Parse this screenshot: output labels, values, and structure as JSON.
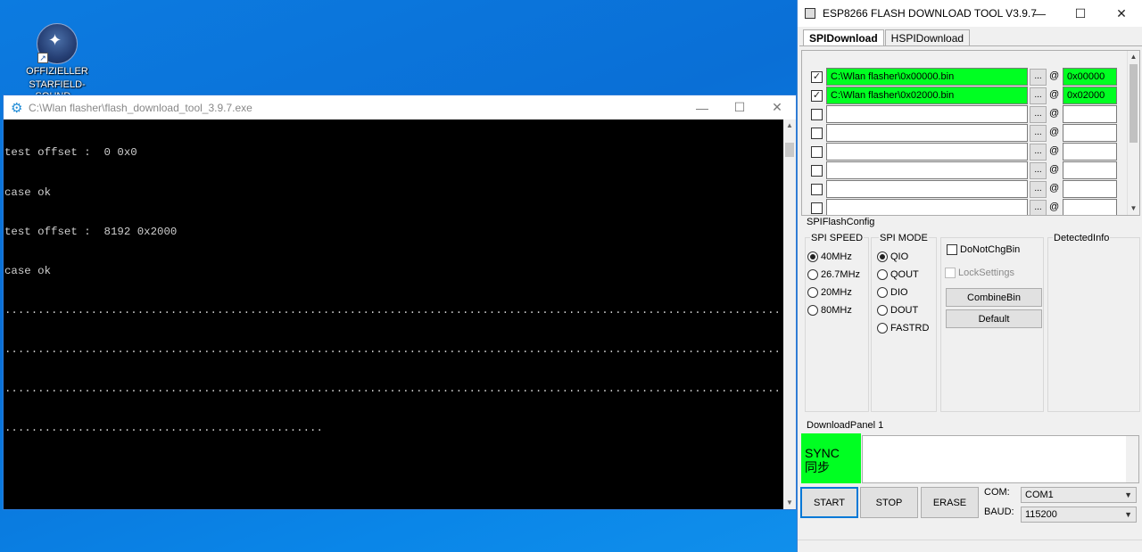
{
  "desktop": {
    "icon_label_1": "OFFIZIELLER",
    "icon_label_2": "STARFIELD-SOUND..."
  },
  "console": {
    "title": "C:\\Wlan flasher\\flash_download_tool_3.9.7.exe",
    "lines": [
      "test offset :  0 0x0",
      "case ok",
      "test offset :  8192 0x2000",
      "case ok",
      "................................................................................................................................................................",
      "................................................................................................................................................................",
      "................................................................................................................................................................",
      "................................................"
    ]
  },
  "esp": {
    "title": "ESP8266 FLASH DOWNLOAD TOOL V3.9.7",
    "tabs": [
      "SPIDownload",
      "HSPIDownload"
    ],
    "files": [
      {
        "checked": true,
        "path": "C:\\Wlan flasher\\0x00000.bin",
        "addr": "0x00000"
      },
      {
        "checked": true,
        "path": "C:\\Wlan flasher\\0x02000.bin",
        "addr": "0x02000"
      },
      {
        "checked": false,
        "path": "",
        "addr": ""
      },
      {
        "checked": false,
        "path": "",
        "addr": ""
      },
      {
        "checked": false,
        "path": "",
        "addr": ""
      },
      {
        "checked": false,
        "path": "",
        "addr": ""
      },
      {
        "checked": false,
        "path": "",
        "addr": ""
      },
      {
        "checked": false,
        "path": "",
        "addr": ""
      }
    ],
    "browse_label": "...",
    "at_label": "@",
    "spi_flash_config": "SPIFlashConfig",
    "spi_speed": {
      "label": "SPI SPEED",
      "options": [
        "40MHz",
        "26.7MHz",
        "20MHz",
        "80MHz"
      ],
      "selected": 0
    },
    "spi_mode": {
      "label": "SPI MODE",
      "options": [
        "QIO",
        "QOUT",
        "DIO",
        "DOUT",
        "FASTRD"
      ],
      "selected": 0
    },
    "do_not_chg_bin": "DoNotChgBin",
    "lock_settings": "LockSettings",
    "combine_bin": "CombineBin",
    "default": "Default",
    "detected_info": "DetectedInfo",
    "download_panel": "DownloadPanel 1",
    "sync_1": "SYNC",
    "sync_2": "同步",
    "start": "START",
    "stop": "STOP",
    "erase": "ERASE",
    "com_label": "COM:",
    "com_value": "COM1",
    "baud_label": "BAUD:",
    "baud_value": "115200"
  },
  "colors": {
    "ok_green": "#00ff22",
    "desktop_blue": "#0a7ae0"
  }
}
